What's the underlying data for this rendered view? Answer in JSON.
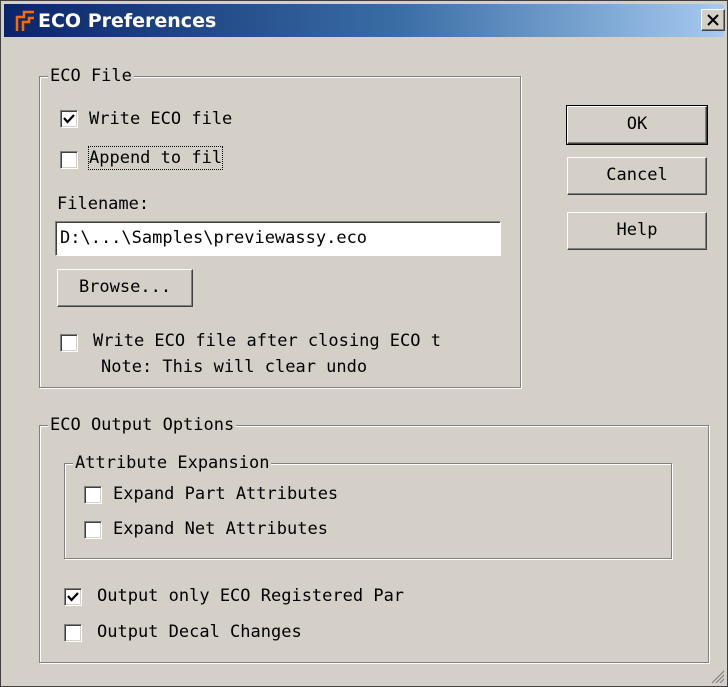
{
  "window": {
    "title": "ECO Preferences",
    "close_glyph": "×"
  },
  "eco_file": {
    "legend": "ECO File",
    "write_eco_file": {
      "label": "Write ECO file",
      "checked": true
    },
    "append_to_file": {
      "label": "Append to fil",
      "checked": false
    },
    "filename_label": "Filename:",
    "filename_value": "D:\\...\\Samples\\previewassy.eco",
    "browse_label": "Browse...",
    "write_after_closing": {
      "label": "Write ECO file after closing ECO t",
      "checked": false
    },
    "note": "Note: This will clear undo"
  },
  "buttons": {
    "ok": "OK",
    "cancel": "Cancel",
    "help": "Help"
  },
  "output_options": {
    "legend": "ECO Output Options",
    "attribute_expansion": {
      "legend": "Attribute Expansion",
      "expand_part": {
        "label": "Expand Part Attributes",
        "checked": false
      },
      "expand_net": {
        "label": "Expand Net Attributes",
        "checked": false
      }
    },
    "output_registered": {
      "label": "Output only ECO Registered Par",
      "checked": true
    },
    "output_decal": {
      "label": "Output Decal Changes",
      "checked": false
    }
  },
  "icons": {
    "app": "pads-logo-icon",
    "close": "close-icon",
    "check": "check-icon",
    "grip": "resize-grip-icon"
  }
}
